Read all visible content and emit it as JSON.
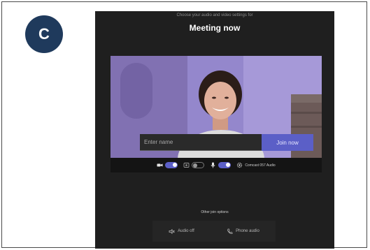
{
  "badge": {
    "letter": "C"
  },
  "prejoin": {
    "subtitle": "Choose your audio and video settings for",
    "meeting_title": "Meeting now",
    "name_placeholder": "Enter name",
    "join_label": "Join now",
    "controls": {
      "camera": {
        "on": true
      },
      "blur": {
        "on": false
      },
      "mic": {
        "on": true
      },
      "audio_device": {
        "label": "Comcast 057 Audio"
      }
    },
    "other_join_label": "Other join options",
    "options": [
      {
        "label": "Audio off",
        "icon": "speaker-off-icon"
      },
      {
        "label": "Phone audio",
        "icon": "phone-icon"
      }
    ]
  },
  "colors": {
    "accent": "#5b5fc7",
    "background": "#1f1f1f",
    "badge": "#1f3a5c"
  }
}
